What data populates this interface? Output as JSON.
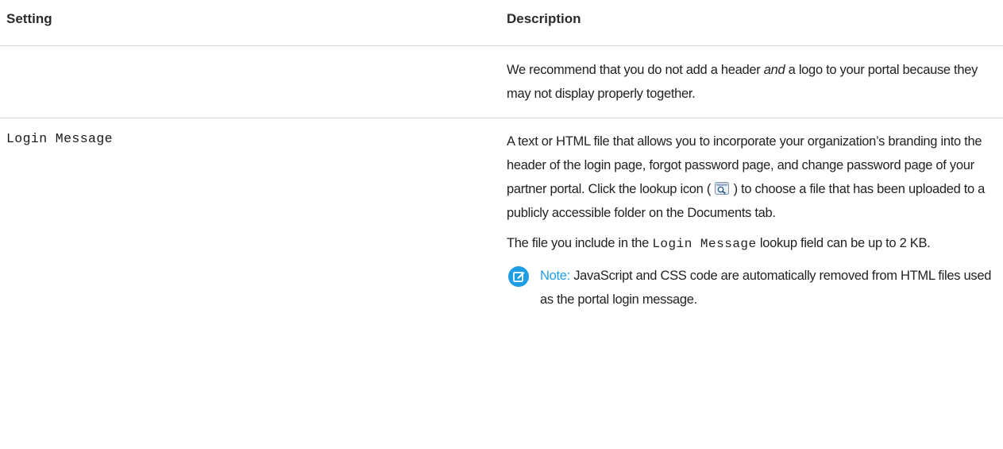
{
  "table": {
    "headers": {
      "setting": "Setting",
      "description": "Description"
    },
    "rows": [
      {
        "setting": "",
        "description": {
          "before": "We recommend that you do not add a header ",
          "emphasis": "and",
          "after": " a logo to your portal because they may not display properly together."
        }
      },
      {
        "setting": "Login Message",
        "description": {
          "p1_before_icon": "A text or HTML file that allows you to incorporate your organization’s branding into the header of the login page, forgot password page, and change password page of your partner portal. Click the lookup icon (",
          "p1_after_icon": ") to choose a file that has been uploaded to a publicly accessible folder on the Documents tab.",
          "p2_before": "The file you include in the ",
          "p2_code": "Login Message",
          "p2_after": " lookup field can be up to 2 KB.",
          "note_label": "Note:",
          "note_text": "JavaScript and CSS code are automatically removed from HTML files used as the portal login message."
        }
      }
    ]
  },
  "icons": {
    "lookup": "lookup-icon",
    "note": "note-icon"
  },
  "colors": {
    "note_accent": "#1e9ee4",
    "rule": "#d6d6d6"
  }
}
